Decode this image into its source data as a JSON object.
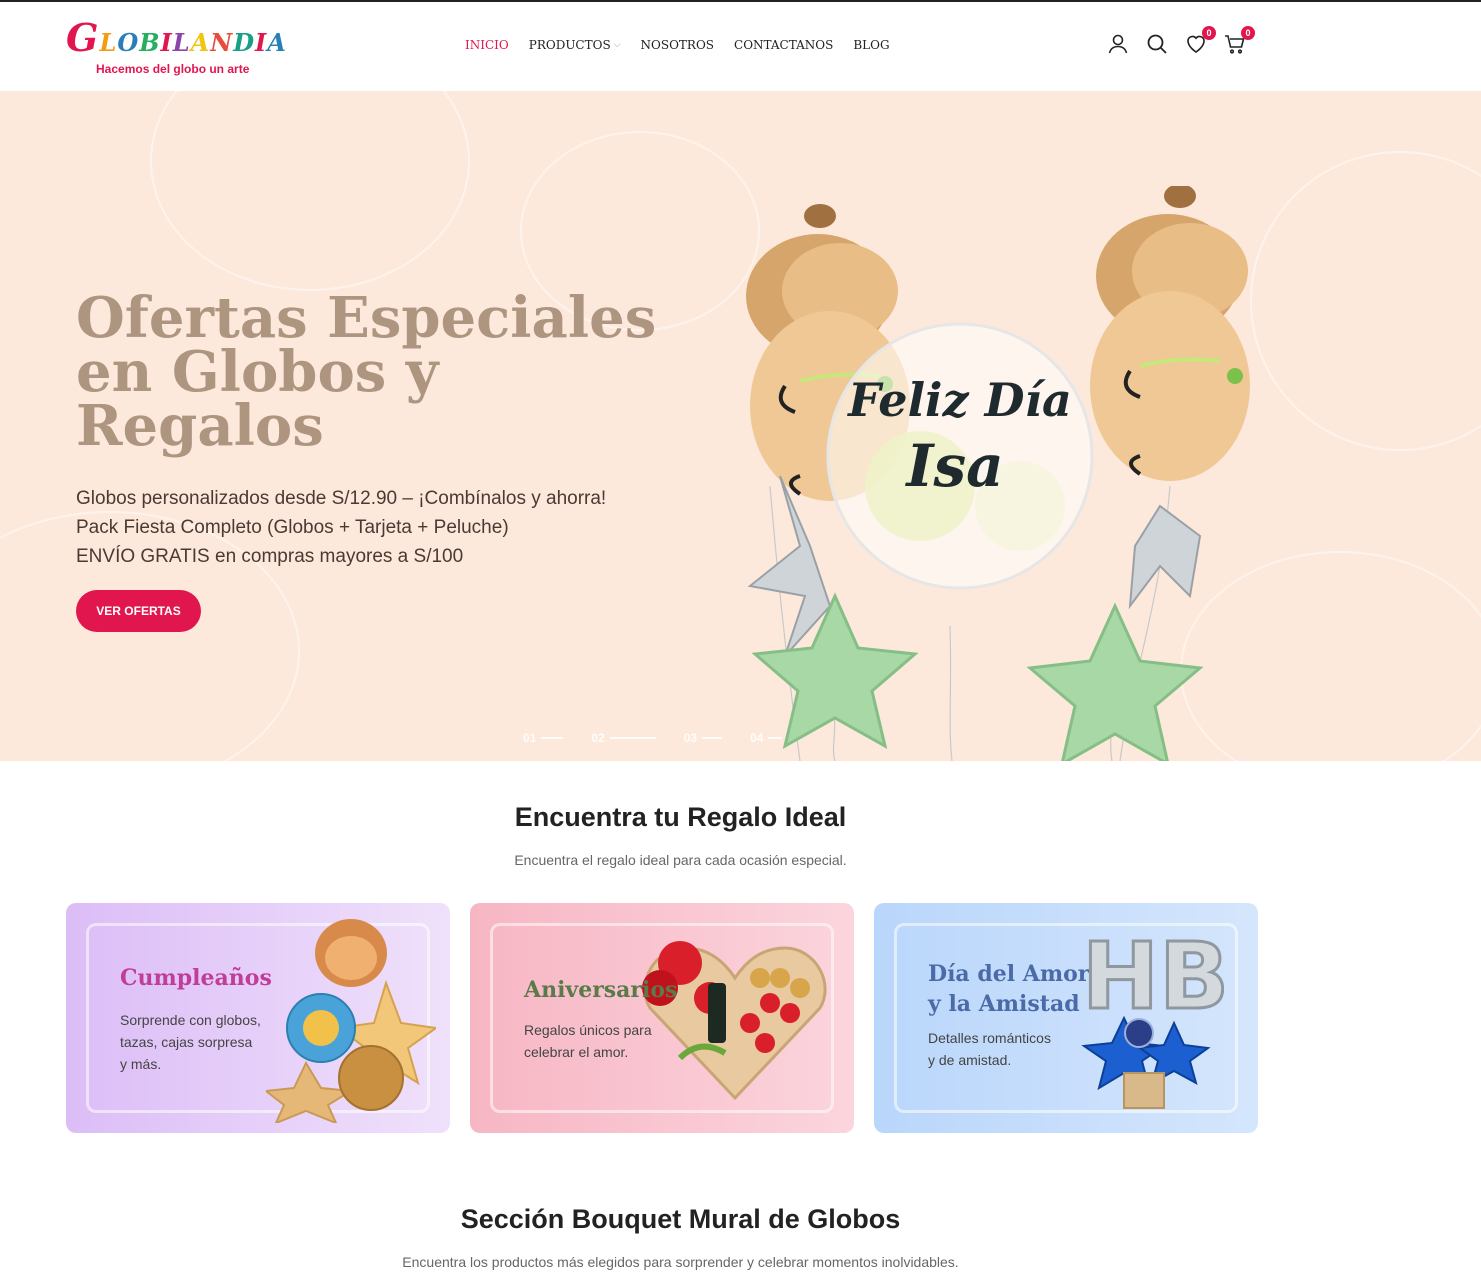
{
  "brand": {
    "name_letters": [
      "G",
      "L",
      "O",
      "B",
      "I",
      "L",
      "A",
      "N",
      "D",
      "I",
      "A"
    ],
    "letter_colors": [
      "#e2164f",
      "#f39c12",
      "#2980b9",
      "#27ae60",
      "#e2164f",
      "#8e44ad",
      "#f1c40f",
      "#e74c3c",
      "#16a085",
      "#e2164f",
      "#2980b9"
    ],
    "tagline": "Hacemos del globo un arte"
  },
  "nav": {
    "items": [
      {
        "label": "INICIO",
        "active": true
      },
      {
        "label": "PRODUCTOS",
        "dropdown": true
      },
      {
        "label": "NOSOTROS"
      },
      {
        "label": "CONTACTANOS"
      },
      {
        "label": "BLOG"
      }
    ]
  },
  "header_icons": {
    "account": "user-icon",
    "search": "search-icon",
    "wishlist": "heart-icon",
    "wishlist_count": "0",
    "cart": "cart-icon",
    "cart_count": "0"
  },
  "hero": {
    "title": "Ofertas Especiales en Globos y Regalos",
    "lines": [
      "Globos personalizados desde S/12.90 – ¡Combínalos y ahorra!",
      "Pack Fiesta Completo (Globos + Tarjeta + Peluche)",
      "ENVÍO GRATIS en compras mayores a S/100"
    ],
    "cta": "VER OFERTAS",
    "balloon_text_1": "Feliz Día",
    "balloon_text_2": "Isa",
    "slides": [
      "01",
      "02",
      "03",
      "04"
    ],
    "active_slide": 2
  },
  "section_gift": {
    "title": "Encuentra tu Regalo Ideal",
    "subtitle": "Encuentra el regalo ideal para cada ocasión especial.",
    "cards": [
      {
        "title": "Cumpleaños",
        "desc": [
          "Sorprende con globos,",
          "tazas, cajas sorpresa",
          "y más."
        ]
      },
      {
        "title": "Aniversarios",
        "desc": [
          "Regalos únicos para",
          "celebrar el amor."
        ]
      },
      {
        "title_lines": [
          "Día del Amor",
          "y la Amistad"
        ],
        "desc": [
          "Detalles románticos",
          "y de amistad."
        ],
        "balloon_letters": "HB"
      }
    ]
  },
  "section_bouquet": {
    "title": "Sección Bouquet Mural de Globos",
    "subtitle": "Encuentra los productos más elegidos para sorprender y celebrar momentos inolvidables."
  },
  "colors": {
    "accent": "#e2164f",
    "hero_bg": "#fde9dc",
    "hero_title": "#ad9580",
    "card1_title": "#c03d9a",
    "card2_title": "#5a7a4a",
    "card3_title": "#4a6aa8"
  }
}
